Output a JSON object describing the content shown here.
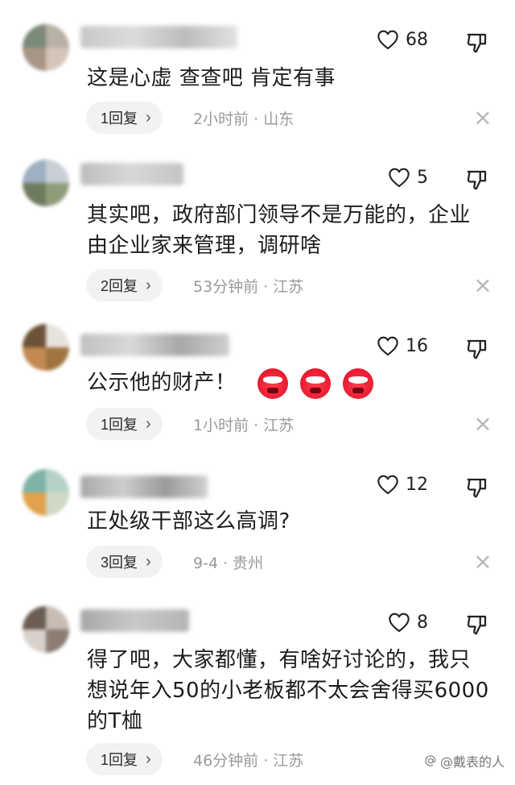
{
  "comments": [
    {
      "text": "这是心虚 查查吧 肯定有事",
      "likes": "68",
      "reply_label": "1回复",
      "meta": "2小时前 · 山东"
    },
    {
      "text": "其实吧，政府部门领导不是万能的，企业由企业家来管理，调研啥",
      "likes": "5",
      "reply_label": "2回复",
      "meta": "53分钟前 · 江苏"
    },
    {
      "text": "公示他的财产！",
      "likes": "16",
      "reply_label": "1回复",
      "meta": "1小时前 · 江苏",
      "emoji_count": 3
    },
    {
      "text": "正处级干部这么高调?",
      "likes": "12",
      "reply_label": "3回复",
      "meta": "9-4 · 贵州"
    },
    {
      "text": "得了吧，大家都懂，有啥好讨论的，我只想说年入50的小老板都不太会舍得买6000的T桖",
      "likes": "8",
      "reply_label": "1回复",
      "meta": "46分钟前 · 江苏"
    }
  ],
  "icons": {
    "like": "heart-outline-icon",
    "dislike": "thumbs-down-outline-icon",
    "reply_chevron": "chevron-right-icon",
    "dismiss": "close-icon",
    "watermark": "at-sign-icon"
  },
  "watermark": {
    "text": "@戴表的人"
  }
}
